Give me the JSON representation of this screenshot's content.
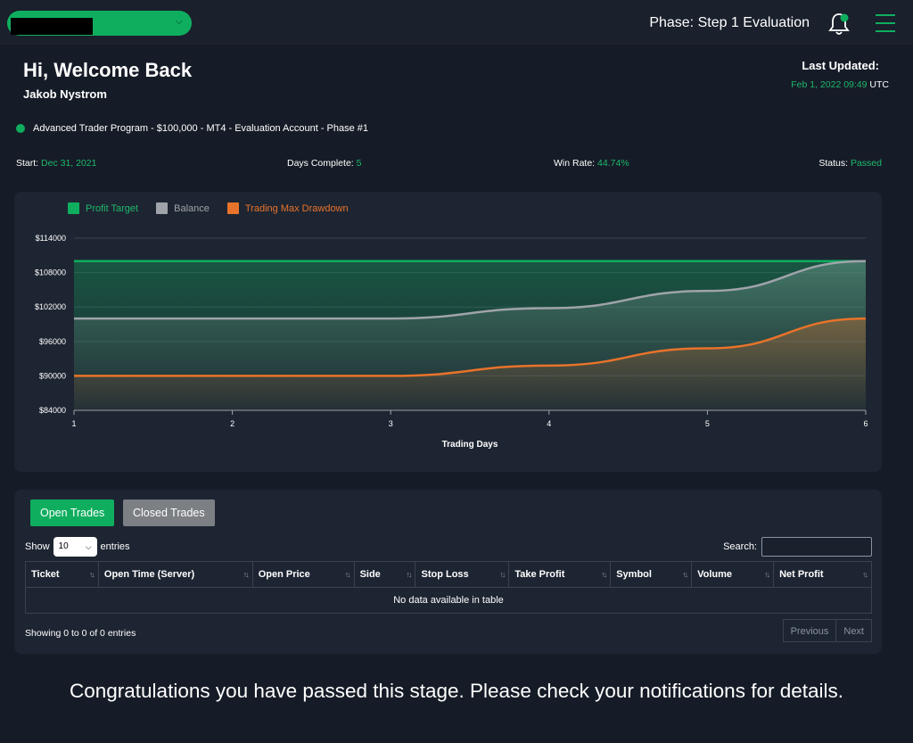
{
  "header": {
    "phase_text": "Phase: Step 1 Evaluation",
    "bell_icon": "bell-icon",
    "menu_icon": "hamburger-menu-icon"
  },
  "welcome": {
    "greeting": "Hi, Welcome Back",
    "name": "Jakob Nystrom",
    "last_updated_label": "Last Updated:",
    "last_updated_date": "Feb 1, 2022 09:49",
    "last_updated_tz": "UTC"
  },
  "program": {
    "label": "Advanced Trader Program - $100,000 - MT4 - Evaluation Account - Phase #1"
  },
  "stats": {
    "start_label": "Start:",
    "start_value": "Dec 31, 2021",
    "days_label": "Days Complete:",
    "days_value": "5",
    "winrate_label": "Win Rate:",
    "winrate_value": "44.74%",
    "status_label": "Status:",
    "status_value": "Passed"
  },
  "colors": {
    "accent": "#0fae5f",
    "balance": "#a0a4aa",
    "drawdown": "#e8732a",
    "bg": "#161c27"
  },
  "chart_data": {
    "type": "line",
    "x": [
      1,
      2,
      3,
      4,
      5,
      6
    ],
    "xlabel": "Trading Days",
    "ylabel": "",
    "ylim": [
      84000,
      114000
    ],
    "yticks": [
      84000,
      90000,
      96000,
      102000,
      108000,
      114000
    ],
    "ytick_labels": [
      "$84000",
      "$90000",
      "$96000",
      "$102000",
      "$108000",
      "$114000"
    ],
    "legend_position": "top-left",
    "series": [
      {
        "name": "Profit Target",
        "color": "#0fae5f",
        "values": [
          110000,
          110000,
          110000,
          110000,
          110000,
          110000
        ]
      },
      {
        "name": "Balance",
        "color": "#a0a4aa",
        "values": [
          100000,
          100000,
          100000,
          101800,
          104800,
          110000
        ]
      },
      {
        "name": "Trading Max Drawdown",
        "color": "#e8732a",
        "values": [
          90000,
          90000,
          90000,
          91800,
          94800,
          100000
        ]
      }
    ]
  },
  "trades": {
    "tab_open": "Open Trades",
    "tab_closed": "Closed Trades",
    "show_label": "Show",
    "entries_label": "entries",
    "page_length": "10",
    "search_label": "Search:",
    "columns": [
      "Ticket",
      "Open Time (Server)",
      "Open Price",
      "Side",
      "Stop Loss",
      "Take Profit",
      "Symbol",
      "Volume",
      "Net Profit"
    ],
    "empty_message": "No data available in table",
    "info": "Showing 0 to 0 of 0 entries",
    "prev_label": "Previous",
    "next_label": "Next"
  },
  "footer": {
    "message": "Congratulations you have passed this stage. Please check your notifications for details."
  }
}
